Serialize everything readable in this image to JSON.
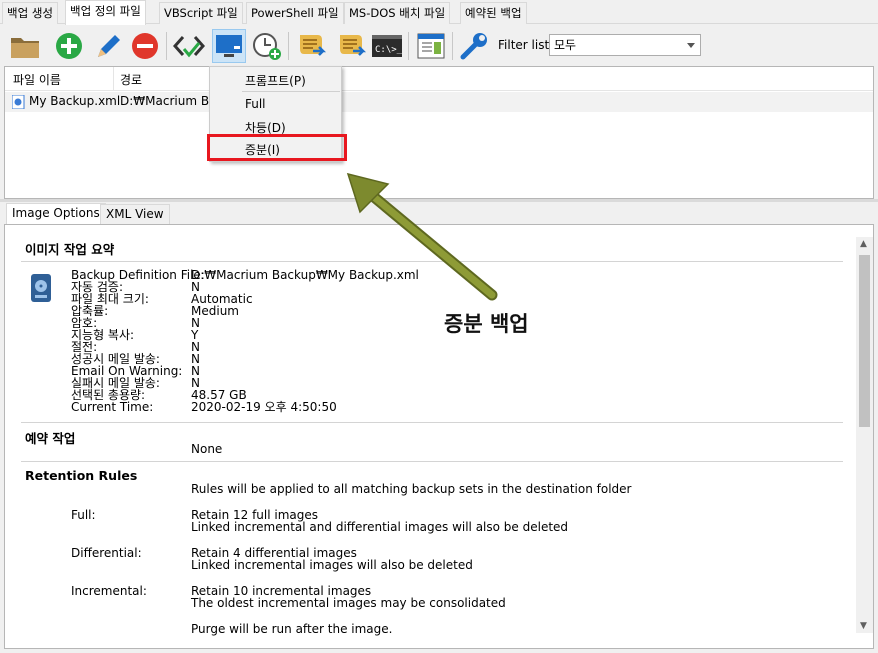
{
  "tabs": [
    "백업 생성",
    "백업 정의 파일",
    "VBScript 파일",
    "PowerShell 파일",
    "MS-DOS 배치 파일",
    "예약된 백업"
  ],
  "toolbar": {
    "filter_label": "Filter list",
    "filter_value": "모두"
  },
  "file_list": {
    "columns": [
      "파일 이름",
      "경로"
    ],
    "rows": [
      {
        "name": "My Backup.xml",
        "path": "D:₩Macrium Bac"
      }
    ]
  },
  "popup_menu": {
    "items": [
      "프롬프트(P)",
      "Full",
      "차등(D)",
      "증분(I)"
    ]
  },
  "bottom_tabs": [
    "Image Options",
    "XML View"
  ],
  "report": {
    "summary_title": "이미지 작업 요약",
    "summary_rows": [
      {
        "label": "Backup Definition File:",
        "value": "D:₩Macrium Backup₩My Backup.xml"
      },
      {
        "label": "자동 검증:",
        "value": "N"
      },
      {
        "label": "파일 최대 크기:",
        "value": "Automatic"
      },
      {
        "label": "압축률:",
        "value": "Medium"
      },
      {
        "label": "암호:",
        "value": "N"
      },
      {
        "label": "지능형 복사:",
        "value": "Y"
      },
      {
        "label": "절전:",
        "value": "N"
      },
      {
        "label": "성공시 메일 발송:",
        "value": "N"
      },
      {
        "label": "Email On Warning:",
        "value": "N"
      },
      {
        "label": "실패시 메일 발송:",
        "value": "N"
      },
      {
        "label": "선택된 총용량:",
        "value": "48.57 GB"
      },
      {
        "label": "Current Time:",
        "value": "2020-02-19 오후 4:50:50"
      }
    ],
    "schedule_title": "예약 작업",
    "schedule_value": "None",
    "retention_title": "Retention Rules",
    "retention_intro": "Rules will be applied to all matching backup sets in the destination folder",
    "retention": [
      {
        "label": "Full:",
        "line1": "Retain 12 full images",
        "line2": "Linked incremental and differential images will also be deleted"
      },
      {
        "label": "Differential:",
        "line1": "Retain 4 differential images",
        "line2": "Linked incremental images will also be deleted"
      },
      {
        "label": "Incremental:",
        "line1": "Retain 10 incremental images",
        "line2": "The oldest incremental images may be consolidated"
      }
    ],
    "purge_text": "Purge will be run after the image."
  },
  "annotation": "증분 백업",
  "colors": {
    "highlight_box": "#e8171f",
    "arrow": "#7d8a2e",
    "selected_button": "#cce4f7"
  },
  "icons": [
    "folder-icon",
    "add-icon",
    "edit-icon",
    "delete-icon",
    "xml-check-icon",
    "backup-image-icon",
    "schedule-icon",
    "vbscript-icon",
    "powershell-icon",
    "msdos-icon",
    "properties-icon",
    "settings-wrench-icon"
  ]
}
